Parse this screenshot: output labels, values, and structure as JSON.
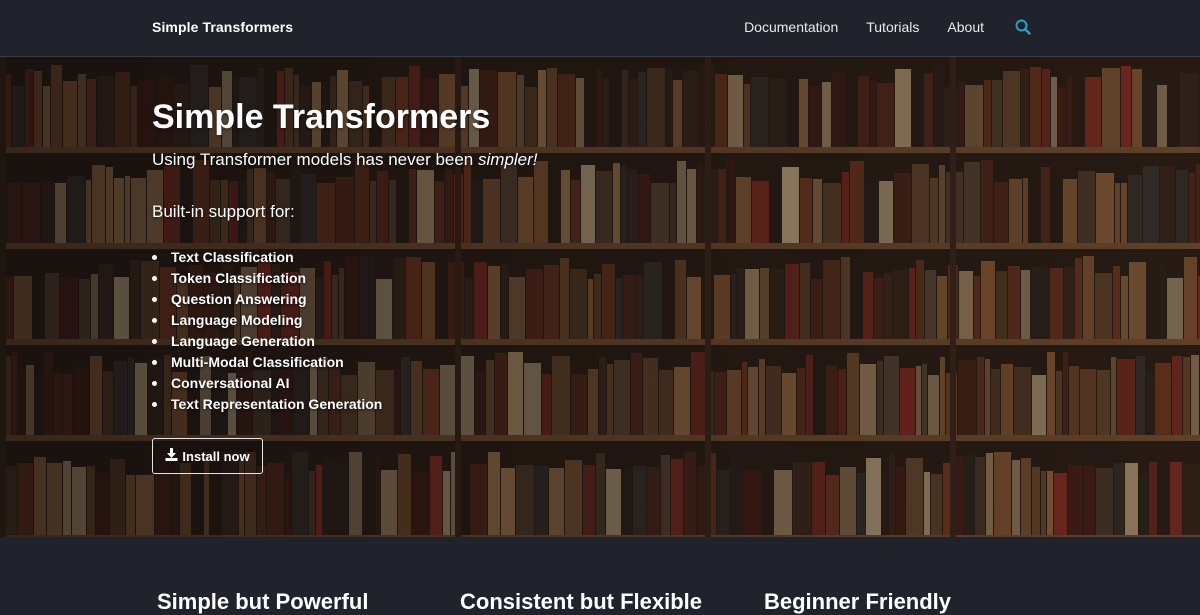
{
  "navbar": {
    "brand": "Simple Transformers",
    "links": [
      "Documentation",
      "Tutorials",
      "About"
    ],
    "search_icon": "search-icon"
  },
  "hero": {
    "title": "Simple Transformers",
    "tagline_prefix": "Using Transformer models has never been ",
    "tagline_emphasis": "simpler!",
    "support_intro": "Built-in support for:",
    "features": [
      "Text Classification",
      "Token Classification",
      "Question Answering",
      "Language Modeling",
      "Language Generation",
      "Multi-Modal Classification",
      "Conversational AI",
      "Text Representation Generation"
    ],
    "install_button": "Install now",
    "install_icon": "download-icon",
    "background": "bookshelf-photo"
  },
  "feature_cards": {
    "headings": [
      "Simple but Powerful",
      "Consistent but Flexible",
      "Beginner Friendly"
    ]
  },
  "colors": {
    "navbar_bg": "#20232b",
    "accent": "#28a2c9",
    "text": "#ffffff"
  }
}
